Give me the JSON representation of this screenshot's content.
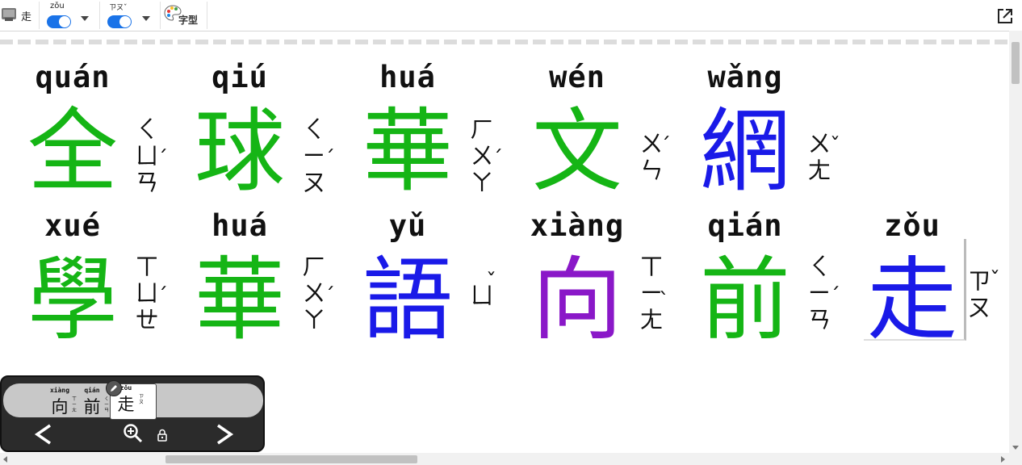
{
  "toolbar": {
    "app_char": "走",
    "pinyin_toggle_label": "zǒu",
    "zhuyin_toggle_label": "ㄗㄡˇ",
    "font_button_label": "字型"
  },
  "colors": {
    "green": "#15b515",
    "blue": "#1a1ae8",
    "purple": "#8a18c8",
    "toggle_on": "#1a73e8"
  },
  "rows": [
    [
      {
        "pinyin": "quán",
        "hanzi": "全",
        "bopomofo": [
          "ㄑ",
          "ㄩ",
          "ㄢ"
        ],
        "tone": "ˊ",
        "color": "#15b515"
      },
      {
        "pinyin": "qiú",
        "hanzi": "球",
        "bopomofo": [
          "ㄑ",
          "ㄧ",
          "ㄡ"
        ],
        "tone": "ˊ",
        "color": "#15b515"
      },
      {
        "pinyin": "huá",
        "hanzi": "華",
        "bopomofo": [
          "ㄏ",
          "ㄨ",
          "ㄚ"
        ],
        "tone": "ˊ",
        "color": "#15b515"
      },
      {
        "pinyin": "wén",
        "hanzi": "文",
        "bopomofo": [
          "ㄨ",
          "ㄣ"
        ],
        "tone": "ˊ",
        "color": "#15b515"
      },
      {
        "pinyin": "wǎng",
        "hanzi": "網",
        "bopomofo": [
          "ㄨ",
          "ㄤ"
        ],
        "tone": "ˇ",
        "color": "#1a1ae8"
      }
    ],
    [
      {
        "pinyin": "xué",
        "hanzi": "學",
        "bopomofo": [
          "ㄒ",
          "ㄩ",
          "ㄝ"
        ],
        "tone": "ˊ",
        "color": "#15b515"
      },
      {
        "pinyin": "huá",
        "hanzi": "華",
        "bopomofo": [
          "ㄏ",
          "ㄨ",
          "ㄚ"
        ],
        "tone": "ˊ",
        "color": "#15b515"
      },
      {
        "pinyin": "yǔ",
        "hanzi": "語",
        "bopomofo": [
          "ㄩ"
        ],
        "tone": "ˇ",
        "color": "#1a1ae8"
      },
      {
        "pinyin": "xiàng",
        "hanzi": "向",
        "bopomofo": [
          "ㄒ",
          "ㄧ",
          "ㄤ"
        ],
        "tone": "ˋ",
        "color": "#8a18c8"
      },
      {
        "pinyin": "qián",
        "hanzi": "前",
        "bopomofo": [
          "ㄑ",
          "ㄧ",
          "ㄢ"
        ],
        "tone": "ˊ",
        "color": "#15b515"
      },
      {
        "pinyin": "zǒu",
        "hanzi": "走",
        "bopomofo": [
          "ㄗ",
          "ㄡ"
        ],
        "tone": "ˇ",
        "color": "#1a1ae8"
      }
    ]
  ],
  "navigator": {
    "items": [
      {
        "pinyin": "xiàng",
        "hanzi": "向",
        "bopomofo": "ㄒㄧㄤ"
      },
      {
        "pinyin": "qián",
        "hanzi": "前",
        "bopomofo": "ㄑㄧㄢ"
      },
      {
        "pinyin": "zǒu",
        "hanzi": "走",
        "bopomofo": "ㄗㄡ"
      }
    ],
    "prev_label": "<",
    "next_label": ">"
  }
}
